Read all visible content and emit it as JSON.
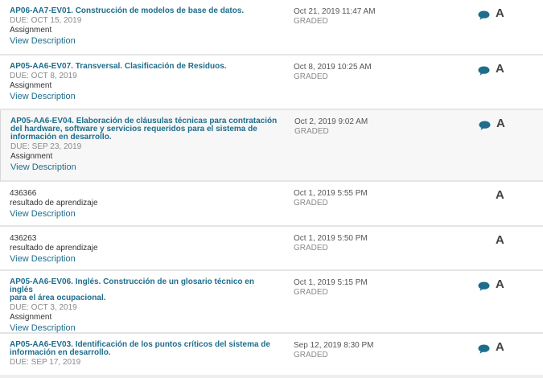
{
  "items": [
    {
      "title": "AP06-AA7-EV01. Construcción de modelos de base de datos.",
      "due": "DUE: OCT 15, 2019",
      "type": "Assignment",
      "link": "View Description",
      "date": "Oct 21, 2019 11:47 AM",
      "status": "GRADED",
      "grade": "A",
      "icon": "comment-icon"
    },
    {
      "title": "AP05-AA6-EV07. Transversal. Clasificación de Residuos.",
      "due": "DUE: OCT 8, 2019",
      "type": "Assignment",
      "link": "View Description",
      "date": "Oct 8, 2019 10:25 AM",
      "status": "GRADED",
      "grade": "A",
      "icon": "comment-icon"
    },
    {
      "title_lines": [
        "AP05-AA6-EV04. Elaboración de cláusulas técnicas para contratación",
        "del hardware, software y servicios requeridos para el sistema de",
        "información en desarrollo."
      ],
      "due": "DUE: SEP 23, 2019",
      "type": "Assignment",
      "link": "View Description",
      "date": "Oct 2, 2019 9:02 AM",
      "status": "GRADED",
      "grade": "A",
      "icon": "comment-icon"
    },
    {
      "id": "436366",
      "type": "resultado de aprendizaje",
      "link": "View Description",
      "date": "Oct 1, 2019 5:55 PM",
      "status": "GRADED",
      "grade": "A"
    },
    {
      "id": "436263",
      "type": "resultado de aprendizaje",
      "link": "View Description",
      "date": "Oct 1, 2019 5:50 PM",
      "status": "GRADED",
      "grade": "A"
    },
    {
      "title_lines": [
        "AP05-AA6-EV06. Inglés. Construcción de un glosario técnico en inglés",
        "para el área ocupacional."
      ],
      "due": "DUE: OCT 3, 2019",
      "type": "Assignment",
      "link": "View Description",
      "date": "Oct 1, 2019 5:15 PM",
      "status": "GRADED",
      "grade": "A",
      "icon": "comment-icon"
    },
    {
      "title_lines": [
        "AP05-AA6-EV03. Identificación de los puntos críticos del sistema de",
        "información en desarrollo."
      ],
      "due": "DUE: SEP 17, 2019",
      "date": "Sep 12, 2019 8:30 PM",
      "status": "GRADED",
      "grade": "A",
      "icon": "comment-icon"
    }
  ],
  "colors": {
    "link": "#1e6d8c",
    "icon": "#1e6d8c",
    "muted": "#8a8a8a"
  }
}
